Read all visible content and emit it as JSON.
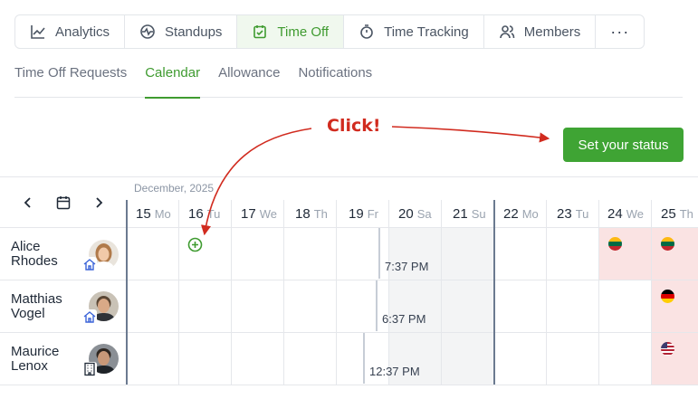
{
  "top_nav": [
    {
      "label": "Analytics",
      "icon": "analytics-icon"
    },
    {
      "label": "Standups",
      "icon": "standups-icon"
    },
    {
      "label": "Time Off",
      "icon": "calendar-check-icon",
      "active": true
    },
    {
      "label": "Time Tracking",
      "icon": "stopwatch-icon"
    },
    {
      "label": "Members",
      "icon": "members-icon"
    },
    {
      "label": "···",
      "icon": "more-icon"
    }
  ],
  "sub_tabs": [
    {
      "label": "Time Off Requests"
    },
    {
      "label": "Calendar",
      "active": true
    },
    {
      "label": "Allowance"
    },
    {
      "label": "Notifications"
    }
  ],
  "set_status_label": "Set your status",
  "annotation": {
    "text": "Click!",
    "color": "#d12b1f"
  },
  "calendar": {
    "month_label": "December, 2025",
    "days": [
      {
        "num": "15",
        "dow": "Mo"
      },
      {
        "num": "16",
        "dow": "Tu"
      },
      {
        "num": "17",
        "dow": "We"
      },
      {
        "num": "18",
        "dow": "Th"
      },
      {
        "num": "19",
        "dow": "Fr"
      },
      {
        "num": "20",
        "dow": "Sa"
      },
      {
        "num": "21",
        "dow": "Su"
      },
      {
        "num": "22",
        "dow": "Mo"
      },
      {
        "num": "23",
        "dow": "Tu"
      },
      {
        "num": "24",
        "dow": "We"
      },
      {
        "num": "25",
        "dow": "Th"
      }
    ],
    "members": [
      {
        "name": "Alice\nRhodes",
        "location_icon": "home-icon",
        "local_time": "7:37 PM",
        "holiday_flag": "lithuania-flag"
      },
      {
        "name": "Matthias\nVogel",
        "location_icon": "home-icon",
        "local_time": "6:37 PM",
        "holiday_flag": "germany-flag"
      },
      {
        "name": "Maurice\nLenox",
        "location_icon": "office-icon",
        "local_time": "12:37 PM",
        "holiday_flag": "usa-flag"
      }
    ]
  },
  "colors": {
    "accent": "#3fa434",
    "holiday": "#fae3e3",
    "annotation": "#d12b1f"
  }
}
